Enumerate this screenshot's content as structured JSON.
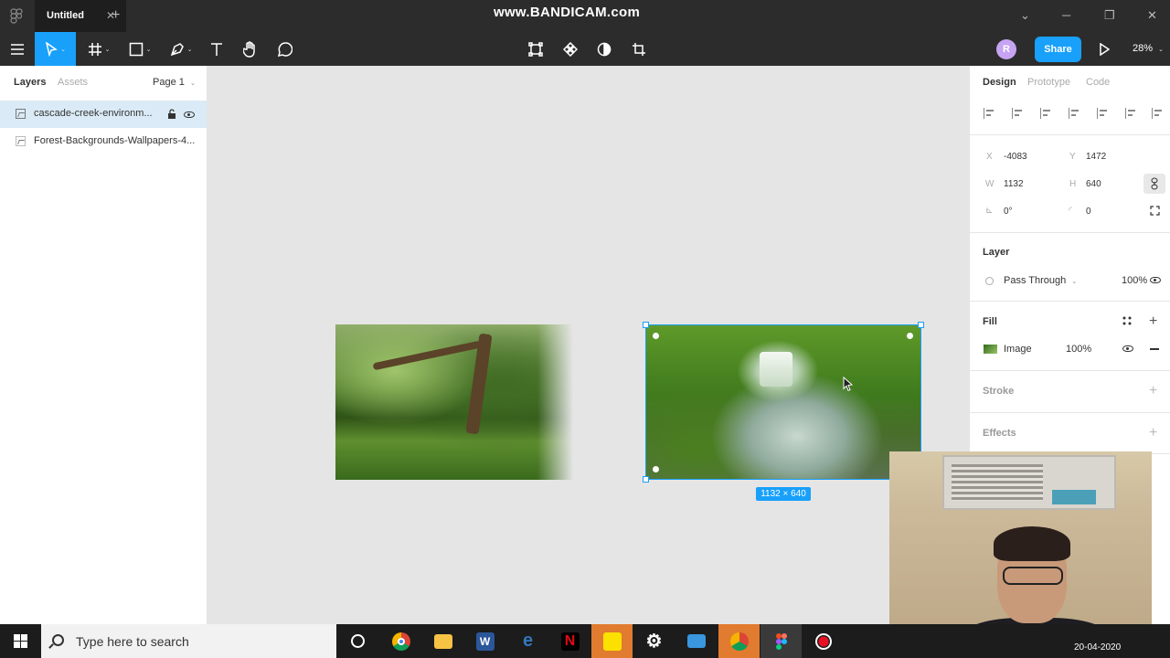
{
  "titlebar": {
    "tab_title": "Untitled",
    "tab_close": "✕",
    "new_tab": "+",
    "watermark": "www.BANDICAM.com",
    "minimize": "─",
    "restore": "❐",
    "close": "✕"
  },
  "toolbar": {
    "avatar_letter": "R",
    "share_label": "Share",
    "zoom": "28%",
    "caret": "⌄"
  },
  "left_panel": {
    "tabs": [
      {
        "label": "Layers",
        "active": true
      },
      {
        "label": "Assets",
        "active": false
      }
    ],
    "page_label": "Page 1",
    "layers": [
      {
        "name": "cascade-creek-environm...",
        "selected": true
      },
      {
        "name": "Forest-Backgrounds-Wallpapers-4...",
        "selected": false
      }
    ]
  },
  "canvas": {
    "selection_size": "1132 × 640"
  },
  "right_panel": {
    "tabs": [
      {
        "label": "Design",
        "active": true
      },
      {
        "label": "Prototype",
        "active": false
      },
      {
        "label": "Code",
        "active": false
      }
    ],
    "properties": {
      "x_label": "X",
      "x_value": "-4083",
      "y_label": "Y",
      "y_value": "1472",
      "w_label": "W",
      "w_value": "1132",
      "h_label": "H",
      "h_value": "640",
      "rotation_label": "⊾",
      "rotation_value": "0°",
      "radius_label": "◜",
      "radius_value": "0"
    },
    "layer_section": {
      "title": "Layer",
      "blend_mode": "Pass Through",
      "opacity": "100%"
    },
    "fill_section": {
      "title": "Fill",
      "type": "Image",
      "opacity": "100%"
    },
    "stroke_title": "Stroke",
    "effects_title": "Effects"
  },
  "taskbar": {
    "search_placeholder": "Type here to search",
    "date": "20-04-2020",
    "apps": [
      {
        "name": "cortana-icon"
      },
      {
        "name": "chrome-icon"
      },
      {
        "name": "file-explorer-icon"
      },
      {
        "name": "word-icon"
      },
      {
        "name": "edge-icon"
      },
      {
        "name": "netflix-icon"
      },
      {
        "name": "sticky-notes-icon"
      },
      {
        "name": "settings-icon"
      },
      {
        "name": "photos-icon"
      },
      {
        "name": "chrome-profile-icon"
      },
      {
        "name": "figma-icon"
      },
      {
        "name": "bandicam-record-icon"
      }
    ]
  },
  "colors": {
    "accent": "#18a0fb",
    "toolbar_bg": "#2c2c2c",
    "canvas_bg": "#e5e5e5",
    "selected_layer": "#daebf7"
  }
}
